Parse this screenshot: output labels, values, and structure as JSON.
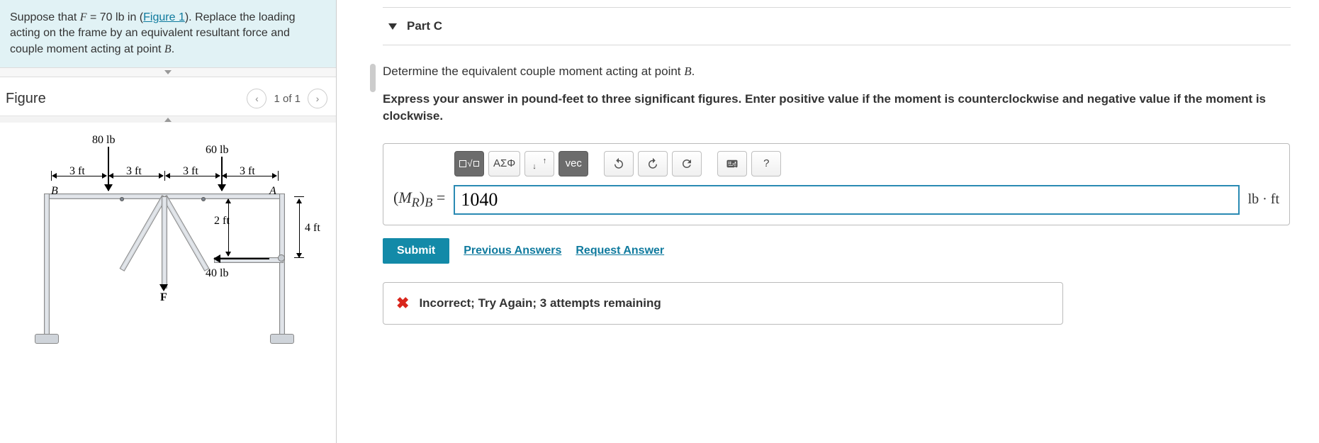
{
  "problem": {
    "text_pre": "Suppose that ",
    "var_F": "F",
    "eq_txt": " = 70 lb in (",
    "figure_link": "Figure 1",
    "text_post": "). Replace the loading acting on the frame by an equivalent resultant force and couple moment acting at point ",
    "var_B": "B",
    "period": "."
  },
  "figure": {
    "title": "Figure",
    "counter": "1 of 1",
    "labels": {
      "load_80": "80 lb",
      "load_60": "60 lb",
      "load_40": "40 lb",
      "dim_3ft_1": "3 ft",
      "dim_3ft_2": "3 ft",
      "dim_3ft_3": "3 ft",
      "dim_3ft_4": "3 ft",
      "dim_2ft": "2 ft",
      "dim_4ft": "4 ft",
      "point_B": "B",
      "point_A": "A",
      "force_F": "F"
    }
  },
  "part": {
    "header": "Part C",
    "prompt_pre": "Determine the equivalent couple moment acting at point ",
    "var_B": "B",
    "period": ".",
    "hint": "Express your answer in pound-feet to three significant figures. Enter positive value if the moment is counterclockwise and negative value if the moment is clockwise.",
    "toolbar": {
      "templates": "⎕√",
      "greek": "ΑΣΦ",
      "subsup": "↓↑",
      "vec": "vec",
      "undo": "↶",
      "redo": "↷",
      "reset": "⟳",
      "keyboard": "⌨",
      "help": "?"
    },
    "answer": {
      "label_html": "(M_R)_B = ",
      "value": "1040",
      "units": "lb · ft"
    },
    "submit": "Submit",
    "prev_answers": "Previous Answers",
    "req_answer": "Request Answer",
    "feedback": {
      "icon": "✖",
      "msg": "Incorrect; Try Again; 3 attempts remaining"
    }
  }
}
